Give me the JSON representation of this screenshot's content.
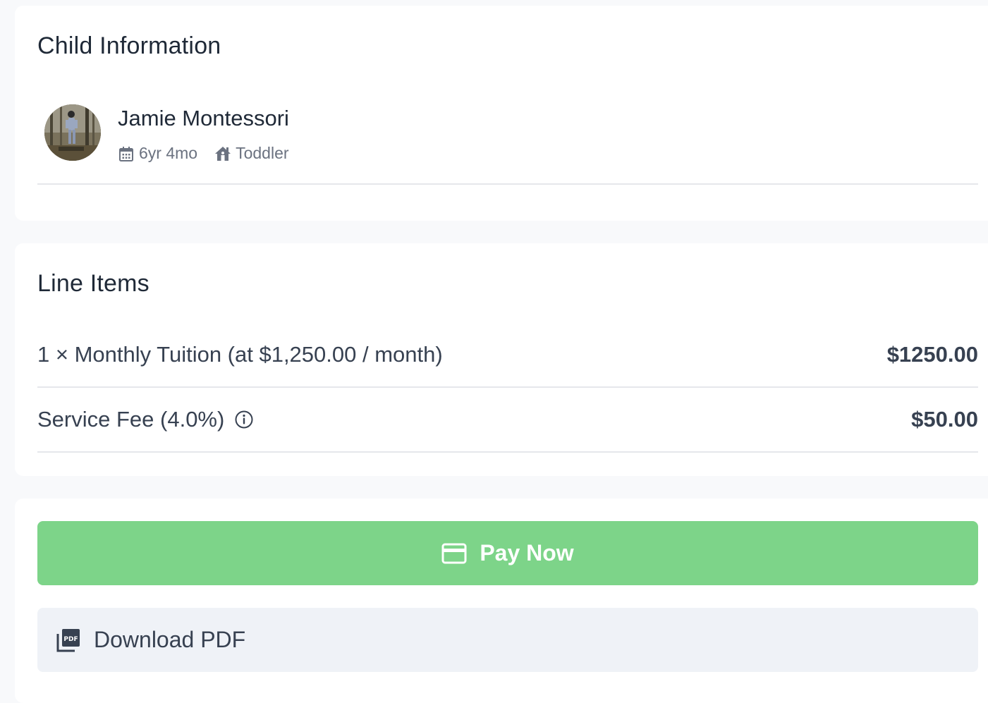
{
  "child_info": {
    "title": "Child Information",
    "name": "Jamie Montessori",
    "age": "6yr 4mo",
    "classroom": "Toddler",
    "age_icon": "calendar-icon",
    "classroom_icon": "home-icon"
  },
  "line_items": {
    "title": "Line Items",
    "items": [
      {
        "description": "1 × Monthly Tuition (at $1,250.00 / month)",
        "amount": "$1250.00"
      },
      {
        "description": "Service Fee (4.0%)",
        "amount": "$50.00",
        "icon": "info-icon"
      }
    ]
  },
  "actions": {
    "pay_label": "Pay Now",
    "pay_icon": "credit-card-icon",
    "pay_color": "#7dd489",
    "download_label": "Download PDF",
    "download_icon": "pdf-icon"
  }
}
